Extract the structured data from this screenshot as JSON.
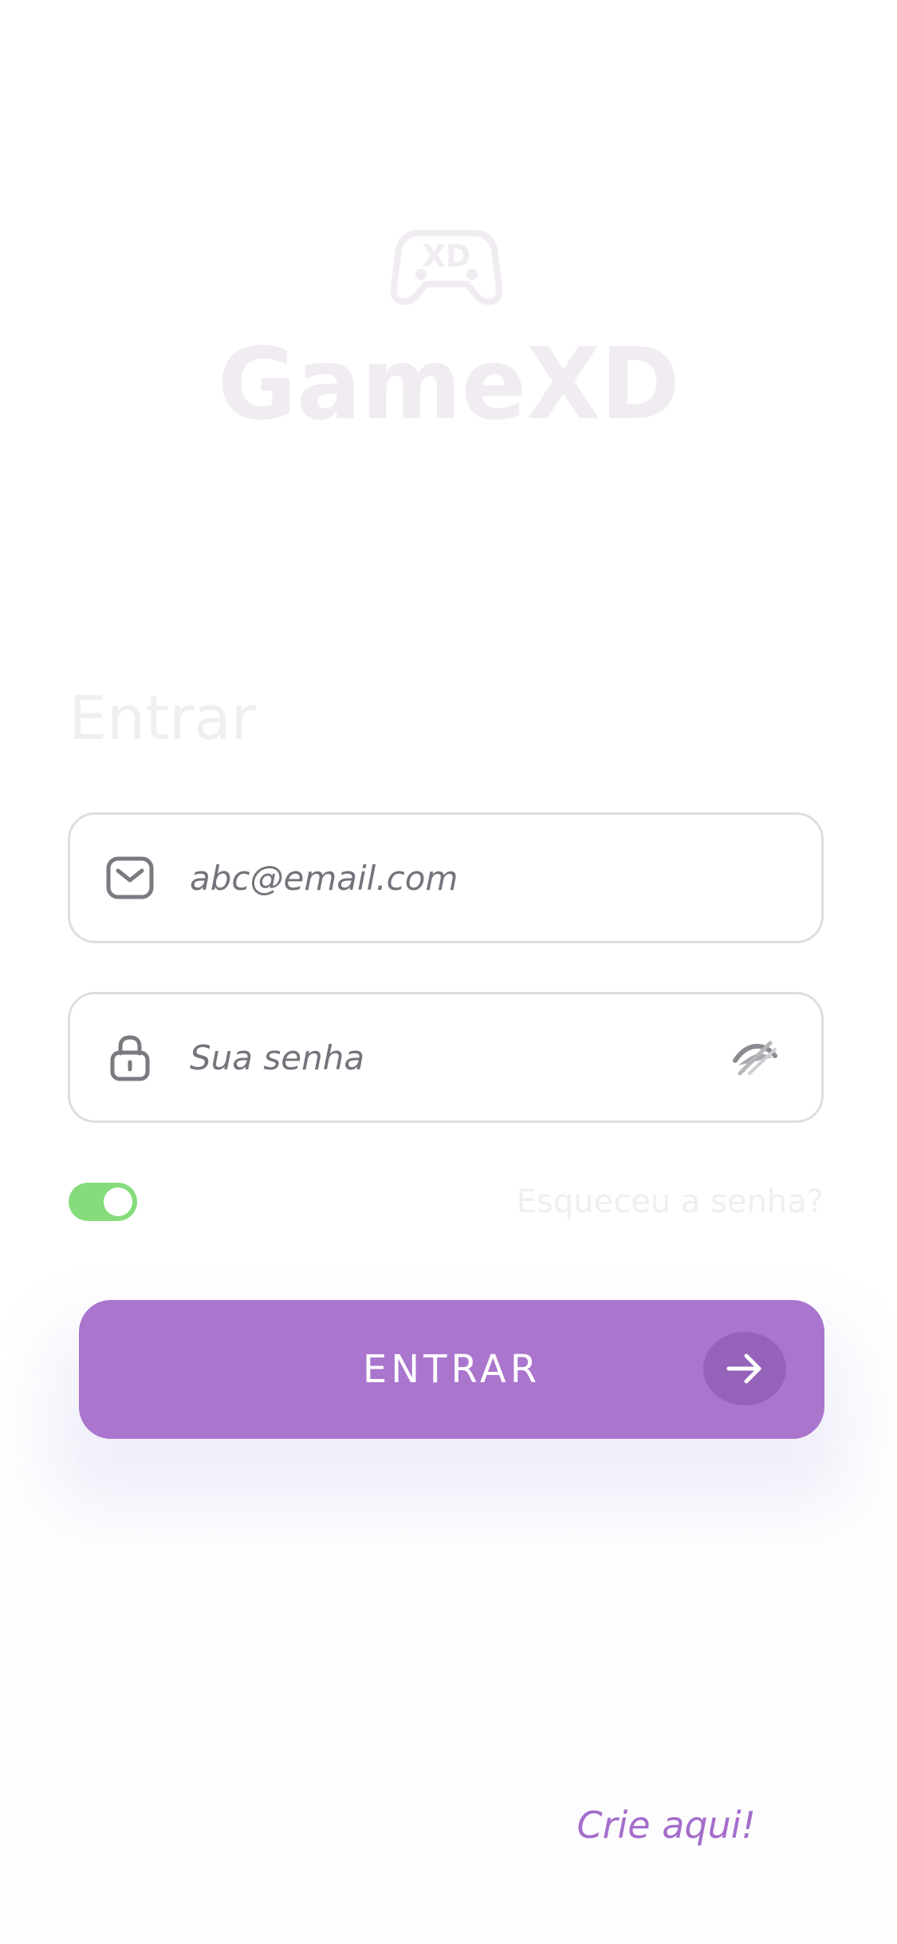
{
  "app": {
    "brand_name": "GameXD",
    "logo_icon": "gamepad-xd-icon"
  },
  "login": {
    "title": "Entrar",
    "email_field": {
      "icon": "mail-icon",
      "placeholder": "abc@email.com",
      "value": ""
    },
    "password_field": {
      "icon": "lock-icon",
      "placeholder": "Sua senha",
      "value": "",
      "visibility_icon": "eye-off-icon"
    },
    "remember_toggle": {
      "on": true
    },
    "forgot_password_label": "Esqueceu a senha?",
    "submit_label": "ENTRAR",
    "submit_icon": "arrow-right-icon",
    "signup_label": "Crie aqui!"
  },
  "colors": {
    "accent": "#aa75cd",
    "accent_dark": "#9562b9",
    "toggle_on": "#86dc7d",
    "link": "#a46dcb",
    "logo": "#f0ecf1",
    "input_border": "#dedde1",
    "placeholder": "#74737b"
  }
}
